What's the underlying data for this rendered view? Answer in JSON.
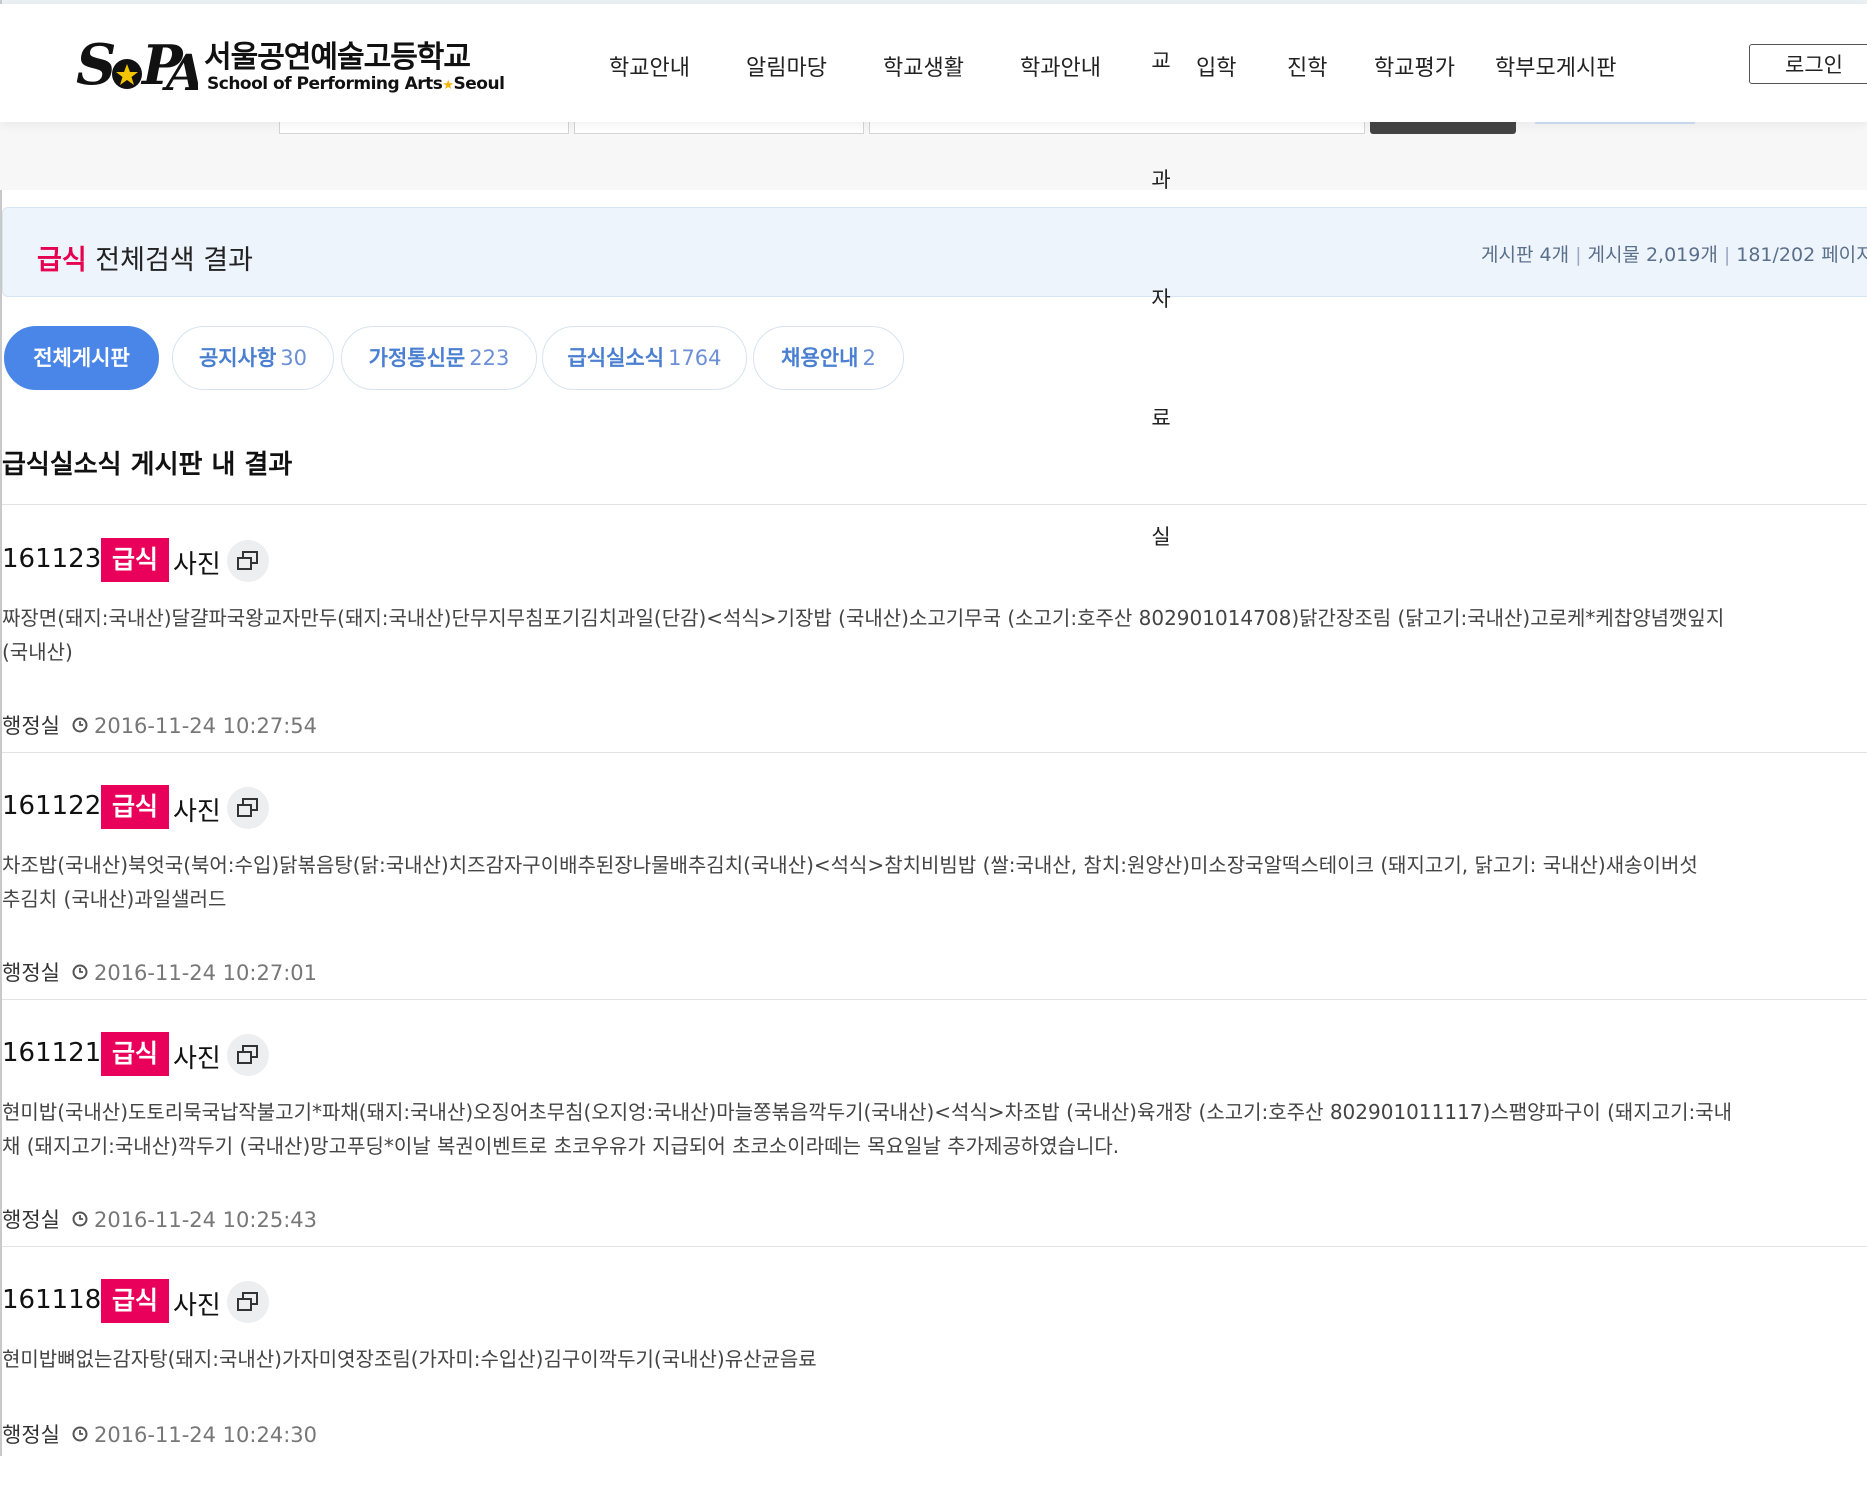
{
  "header": {
    "logo_korean": "서울공연예술고등학교",
    "logo_english_1": "School of Performing Arts",
    "logo_english_2": "Seoul",
    "nav": [
      "학교안내",
      "알림마당",
      "학교생활",
      "학과안내",
      "입학",
      "진학",
      "학교평가",
      "학부모게시판"
    ],
    "nav_vertical": [
      "교",
      "과",
      "자",
      "료",
      "실"
    ],
    "login_label": "로그인"
  },
  "summary": {
    "keyword": "급식",
    "title_suffix": "전체검색 결과",
    "stat_boards": "게시판 4개",
    "stat_posts": "게시물 2,019개",
    "stat_pages": "181/202 페이지"
  },
  "tabs": [
    {
      "label": "전체게시판",
      "count": ""
    },
    {
      "label": "공지사항",
      "count": "30"
    },
    {
      "label": "가정통신문",
      "count": "223"
    },
    {
      "label": "급식실소식",
      "count": "1764"
    },
    {
      "label": "채용안내",
      "count": "2"
    }
  ],
  "section_title": "급식실소식 게시판 내 결과",
  "posts": [
    {
      "number": "161123",
      "keyword": "급식",
      "after": "사진",
      "body_line1": "짜장면(돼지:국내산)달걀파국왕교자만두(돼지:국내산)단무지무침포기김치과일(단감)<석식>기장밥 (국내산)소고기무국 (소고기:호주산 802901014708)닭간장조림 (닭고기:국내산)고로케*케찹양념깻잎지",
      "body_line2": "(국내산)",
      "author": "행정실",
      "date": "2016-11-24 10:27:54"
    },
    {
      "number": "161122",
      "keyword": "급식",
      "after": "사진",
      "body_line1": "차조밥(국내산)북엇국(북어:수입)닭볶음탕(닭:국내산)치즈감자구이배추된장나물배추김치(국내산)<석식>참치비빔밥 (쌀:국내산, 참치:원양산)미소장국알떡스테이크 (돼지고기, 닭고기: 국내산)새송이버섯",
      "body_line2": "추김치 (국내산)과일샐러드",
      "author": "행정실",
      "date": "2016-11-24 10:27:01"
    },
    {
      "number": "161121",
      "keyword": "급식",
      "after": "사진",
      "body_line1": "현미밥(국내산)도토리묵국납작불고기*파채(돼지:국내산)오징어초무침(오지엉:국내산)마늘쫑볶음깍두기(국내산)<석식>차조밥 (국내산)육개장 (소고기:호주산 802901011117)스팸양파구이 (돼지고기:국내",
      "body_line2": "채 (돼지고기:국내산)깍두기 (국내산)망고푸딩*이날 복권이벤트로 초코우유가 지급되어 초코소이라떼는 목요일날 추가제공하였습니다.",
      "author": "행정실",
      "date": "2016-11-24 10:25:43"
    },
    {
      "number": "161118",
      "keyword": "급식",
      "after": "사진",
      "body_line1": "현미밥뼈없는감자탕(돼지:국내산)가자미엿장조림(가자미:수입산)김구이깍두기(국내산)유산균음료",
      "body_line2": "",
      "author": "행정실",
      "date": "2016-11-24 10:24:30"
    }
  ],
  "colors": {
    "accent_pink": "#e8005a",
    "tab_blue": "#4a86e8",
    "summary_bg": "#eef4fc"
  }
}
